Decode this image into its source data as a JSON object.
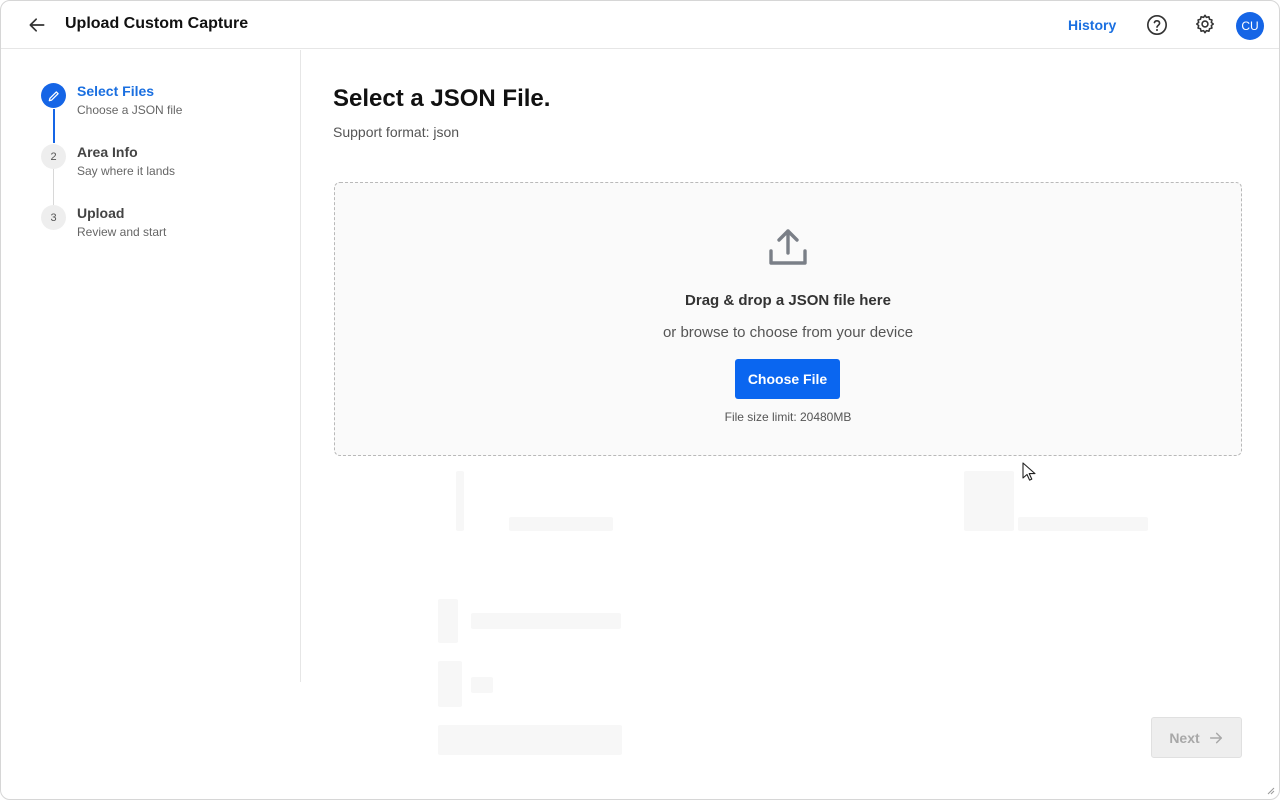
{
  "header": {
    "title": "Upload Custom Capture",
    "history_label": "History",
    "avatar_initials": "CU",
    "icons": [
      "arrow-left-icon",
      "help-icon",
      "gear-icon"
    ]
  },
  "steps": [
    {
      "number": "",
      "title": "Select Files",
      "subtitle": "Choose a JSON file",
      "state": "active"
    },
    {
      "number": "2",
      "title": "Area Info",
      "subtitle": "Say where it lands",
      "state": "pending"
    },
    {
      "number": "3",
      "title": "Upload",
      "subtitle": "Review and start",
      "state": "pending"
    }
  ],
  "main": {
    "title": "Select a JSON File.",
    "subtitle": "Support format: json",
    "dropzone": {
      "title": "Drag & drop a JSON file here",
      "subtitle": "or browse to choose from your device",
      "button_label": "Choose File",
      "size_limit": "File size limit: 20480MB"
    },
    "next_label": "Next"
  },
  "colors": {
    "accent": "#1565e6",
    "link": "#1a6fe0",
    "button": "#0a66f0",
    "disabled": "#eeeeee"
  }
}
